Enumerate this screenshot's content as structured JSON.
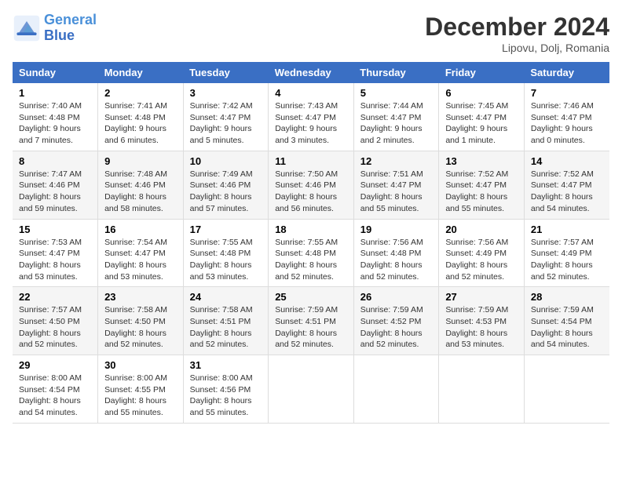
{
  "header": {
    "logo_line1": "General",
    "logo_line2": "Blue",
    "month": "December 2024",
    "location": "Lipovu, Dolj, Romania"
  },
  "columns": [
    "Sunday",
    "Monday",
    "Tuesday",
    "Wednesday",
    "Thursday",
    "Friday",
    "Saturday"
  ],
  "weeks": [
    [
      {
        "day": "1",
        "sunrise": "Sunrise: 7:40 AM",
        "sunset": "Sunset: 4:48 PM",
        "daylight": "Daylight: 9 hours and 7 minutes."
      },
      {
        "day": "2",
        "sunrise": "Sunrise: 7:41 AM",
        "sunset": "Sunset: 4:48 PM",
        "daylight": "Daylight: 9 hours and 6 minutes."
      },
      {
        "day": "3",
        "sunrise": "Sunrise: 7:42 AM",
        "sunset": "Sunset: 4:47 PM",
        "daylight": "Daylight: 9 hours and 5 minutes."
      },
      {
        "day": "4",
        "sunrise": "Sunrise: 7:43 AM",
        "sunset": "Sunset: 4:47 PM",
        "daylight": "Daylight: 9 hours and 3 minutes."
      },
      {
        "day": "5",
        "sunrise": "Sunrise: 7:44 AM",
        "sunset": "Sunset: 4:47 PM",
        "daylight": "Daylight: 9 hours and 2 minutes."
      },
      {
        "day": "6",
        "sunrise": "Sunrise: 7:45 AM",
        "sunset": "Sunset: 4:47 PM",
        "daylight": "Daylight: 9 hours and 1 minute."
      },
      {
        "day": "7",
        "sunrise": "Sunrise: 7:46 AM",
        "sunset": "Sunset: 4:47 PM",
        "daylight": "Daylight: 9 hours and 0 minutes."
      }
    ],
    [
      {
        "day": "8",
        "sunrise": "Sunrise: 7:47 AM",
        "sunset": "Sunset: 4:46 PM",
        "daylight": "Daylight: 8 hours and 59 minutes."
      },
      {
        "day": "9",
        "sunrise": "Sunrise: 7:48 AM",
        "sunset": "Sunset: 4:46 PM",
        "daylight": "Daylight: 8 hours and 58 minutes."
      },
      {
        "day": "10",
        "sunrise": "Sunrise: 7:49 AM",
        "sunset": "Sunset: 4:46 PM",
        "daylight": "Daylight: 8 hours and 57 minutes."
      },
      {
        "day": "11",
        "sunrise": "Sunrise: 7:50 AM",
        "sunset": "Sunset: 4:46 PM",
        "daylight": "Daylight: 8 hours and 56 minutes."
      },
      {
        "day": "12",
        "sunrise": "Sunrise: 7:51 AM",
        "sunset": "Sunset: 4:47 PM",
        "daylight": "Daylight: 8 hours and 55 minutes."
      },
      {
        "day": "13",
        "sunrise": "Sunrise: 7:52 AM",
        "sunset": "Sunset: 4:47 PM",
        "daylight": "Daylight: 8 hours and 55 minutes."
      },
      {
        "day": "14",
        "sunrise": "Sunrise: 7:52 AM",
        "sunset": "Sunset: 4:47 PM",
        "daylight": "Daylight: 8 hours and 54 minutes."
      }
    ],
    [
      {
        "day": "15",
        "sunrise": "Sunrise: 7:53 AM",
        "sunset": "Sunset: 4:47 PM",
        "daylight": "Daylight: 8 hours and 53 minutes."
      },
      {
        "day": "16",
        "sunrise": "Sunrise: 7:54 AM",
        "sunset": "Sunset: 4:47 PM",
        "daylight": "Daylight: 8 hours and 53 minutes."
      },
      {
        "day": "17",
        "sunrise": "Sunrise: 7:55 AM",
        "sunset": "Sunset: 4:48 PM",
        "daylight": "Daylight: 8 hours and 53 minutes."
      },
      {
        "day": "18",
        "sunrise": "Sunrise: 7:55 AM",
        "sunset": "Sunset: 4:48 PM",
        "daylight": "Daylight: 8 hours and 52 minutes."
      },
      {
        "day": "19",
        "sunrise": "Sunrise: 7:56 AM",
        "sunset": "Sunset: 4:48 PM",
        "daylight": "Daylight: 8 hours and 52 minutes."
      },
      {
        "day": "20",
        "sunrise": "Sunrise: 7:56 AM",
        "sunset": "Sunset: 4:49 PM",
        "daylight": "Daylight: 8 hours and 52 minutes."
      },
      {
        "day": "21",
        "sunrise": "Sunrise: 7:57 AM",
        "sunset": "Sunset: 4:49 PM",
        "daylight": "Daylight: 8 hours and 52 minutes."
      }
    ],
    [
      {
        "day": "22",
        "sunrise": "Sunrise: 7:57 AM",
        "sunset": "Sunset: 4:50 PM",
        "daylight": "Daylight: 8 hours and 52 minutes."
      },
      {
        "day": "23",
        "sunrise": "Sunrise: 7:58 AM",
        "sunset": "Sunset: 4:50 PM",
        "daylight": "Daylight: 8 hours and 52 minutes."
      },
      {
        "day": "24",
        "sunrise": "Sunrise: 7:58 AM",
        "sunset": "Sunset: 4:51 PM",
        "daylight": "Daylight: 8 hours and 52 minutes."
      },
      {
        "day": "25",
        "sunrise": "Sunrise: 7:59 AM",
        "sunset": "Sunset: 4:51 PM",
        "daylight": "Daylight: 8 hours and 52 minutes."
      },
      {
        "day": "26",
        "sunrise": "Sunrise: 7:59 AM",
        "sunset": "Sunset: 4:52 PM",
        "daylight": "Daylight: 8 hours and 52 minutes."
      },
      {
        "day": "27",
        "sunrise": "Sunrise: 7:59 AM",
        "sunset": "Sunset: 4:53 PM",
        "daylight": "Daylight: 8 hours and 53 minutes."
      },
      {
        "day": "28",
        "sunrise": "Sunrise: 7:59 AM",
        "sunset": "Sunset: 4:54 PM",
        "daylight": "Daylight: 8 hours and 54 minutes."
      }
    ],
    [
      {
        "day": "29",
        "sunrise": "Sunrise: 8:00 AM",
        "sunset": "Sunset: 4:54 PM",
        "daylight": "Daylight: 8 hours and 54 minutes."
      },
      {
        "day": "30",
        "sunrise": "Sunrise: 8:00 AM",
        "sunset": "Sunset: 4:55 PM",
        "daylight": "Daylight: 8 hours and 55 minutes."
      },
      {
        "day": "31",
        "sunrise": "Sunrise: 8:00 AM",
        "sunset": "Sunset: 4:56 PM",
        "daylight": "Daylight: 8 hours and 55 minutes."
      },
      null,
      null,
      null,
      null
    ]
  ]
}
